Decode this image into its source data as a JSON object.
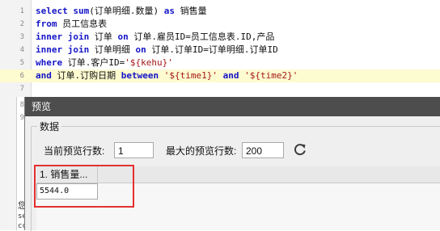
{
  "editor": {
    "lines": [
      {
        "num": "1"
      },
      {
        "num": "2"
      },
      {
        "num": "3"
      },
      {
        "num": "4"
      },
      {
        "num": "5"
      },
      {
        "num": "6"
      },
      {
        "num": "7"
      },
      {
        "num": "8"
      },
      {
        "num": "9"
      }
    ],
    "code": {
      "l1_kw1": "select",
      "l1_kw2": "sum",
      "l1_t1": "(订单明细.数量)",
      "l1_kw3": "as",
      "l1_t2": "销售量",
      "l2_kw": "from",
      "l2_t": "员工信息表",
      "l3_kw1": "inner join",
      "l3_t1": "订单",
      "l3_kw2": "on",
      "l3_t2": "订单.雇员ID=员工信息表.ID,产品",
      "l4_kw1": "inner join",
      "l4_t1": "订单明细",
      "l4_kw2": "on",
      "l4_t2": "订单.订单ID=订单明细.订单ID",
      "l5_kw": "where",
      "l5_t": "订单.客户ID=",
      "l5_s": "'${kehu}'",
      "l6_kw1": "and",
      "l6_t1": "订单.订购日期",
      "l6_kw2": "between",
      "l6_s1": "'${time1}'",
      "l6_kw3": "and",
      "l6_s2": "'${time2}'"
    }
  },
  "underlying": {
    "frag1": "您",
    "frag2": "se",
    "frag3": "cc"
  },
  "dialog": {
    "title": "预览",
    "group_label": "数据",
    "current_rows_label": "当前预览行数:",
    "current_rows_value": "1",
    "max_rows_label": "最大的预览行数:",
    "max_rows_value": "200",
    "refresh_icon": "refresh-icon",
    "column_header": "1. 销售量...",
    "cell_value": "5544.0"
  },
  "colors": {
    "keyword": "#1414c8",
    "string": "#a51616",
    "highlight_line": "#fdfbd0",
    "titlebar": "#4d4d4d",
    "annotation": "#e53030"
  }
}
